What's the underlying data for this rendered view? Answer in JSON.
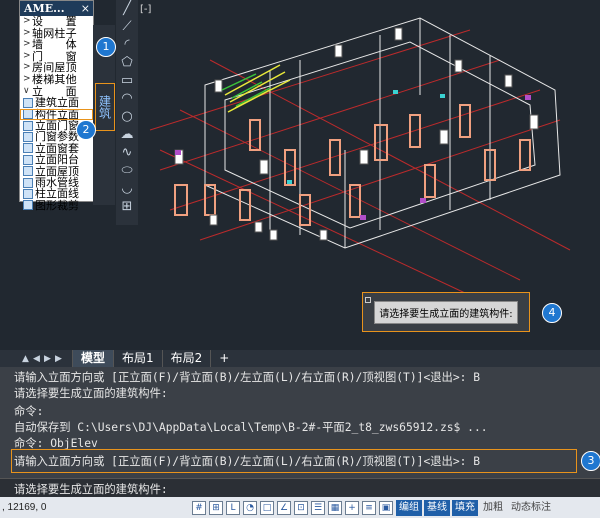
{
  "side_panel": {
    "title": "AME...",
    "close": "×",
    "menu": [
      {
        "chev": ">",
        "label": "设　　置"
      },
      {
        "chev": ">",
        "label": "轴网柱子"
      },
      {
        "chev": ">",
        "label": "墙　　体"
      },
      {
        "chev": ">",
        "label": "门　　窗"
      },
      {
        "chev": ">",
        "label": "房间屋顶"
      },
      {
        "chev": ">",
        "label": "楼梯其他"
      },
      {
        "chev": "∨",
        "label": "立　　面"
      }
    ],
    "sub_items": [
      "建筑立面",
      "构件立面",
      "立面门窗",
      "门窗参数",
      "立面窗套",
      "立面阳台",
      "立面屋顶",
      "雨水管线",
      "柱立面线",
      "图形裁剪"
    ]
  },
  "tab_vertical": "建筑",
  "view_label": "[-]",
  "badges": [
    "1",
    "2",
    "3",
    "4"
  ],
  "tooltip": "请选择要生成立面的建筑构件:",
  "layout_tabs": {
    "model": "模型",
    "layout1": "布局1",
    "layout2": "布局2",
    "add": "+"
  },
  "command_history": [
    "请输入立面方向或 [正立面(F)/背立面(B)/左立面(L)/右立面(R)/顶视图(T)]<退出>: B",
    "请选择要生成立面的建筑构件:",
    "命令:",
    "自动保存到 C:\\Users\\DJ\\AppData\\Local\\Temp\\B-2#-平面2_t8_zws65912.zs$ ...",
    "命令: ObjElev",
    "请输入立面方向或 [正立面(F)/背立面(B)/左立面(L)/右立面(R)/顶视图(T)]<退出>: B"
  ],
  "command_input": "请选择要生成立面的建筑构件:",
  "status": {
    "coords": ", 12169, 0",
    "buttons": [
      "编组",
      "基线",
      "填充"
    ],
    "extra": [
      "加粗",
      "动态标注"
    ]
  },
  "colors": {
    "accent_orange": "#e8931c",
    "badge_blue": "#1f77d0"
  }
}
